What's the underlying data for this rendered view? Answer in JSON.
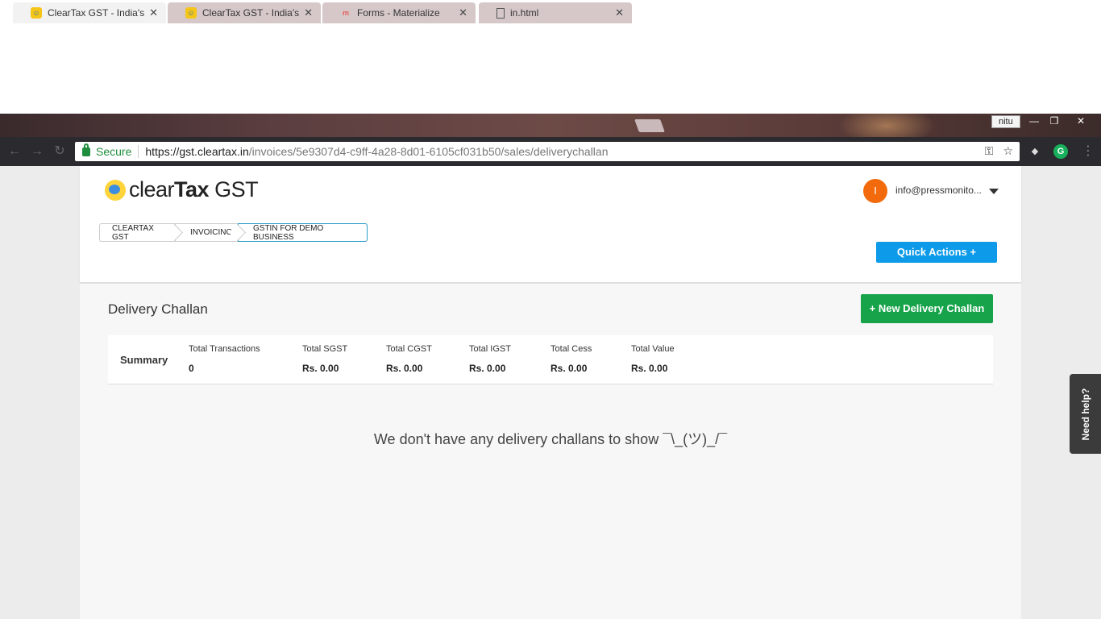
{
  "browser": {
    "tabs": [
      {
        "title": "ClearTax GST - India's fir",
        "favicon": "cleartax-favicon",
        "active": true
      },
      {
        "title": "ClearTax GST - India's fir",
        "favicon": "cleartax-favicon",
        "active": false
      },
      {
        "title": "Forms - Materialize",
        "favicon": "materialize-favicon",
        "active": false
      },
      {
        "title": "in.html",
        "favicon": "file-icon",
        "active": false
      }
    ],
    "profile_name": "nitu",
    "secure_label": "Secure",
    "url_host": "https://gst.cleartax.in",
    "url_path": "/invoices/5e9307d4-c9ff-4a28-8d01-6105cf031b50/sales/deliverychallan"
  },
  "header": {
    "logo_text_light": "clear",
    "logo_text_bold": "Tax",
    "logo_text_suffix": " GST",
    "avatar_initial": "I",
    "user_email": "info@pressmonito...",
    "breadcrumb": [
      "CLEARTAX GST",
      "INVOICING",
      "GSTIN FOR DEMO BUSINESS"
    ],
    "quick_actions_label": "Quick Actions +"
  },
  "main": {
    "title": "Delivery Challan",
    "new_button_label": "+ New Delivery Challan",
    "summary": {
      "label": "Summary",
      "metrics": [
        {
          "label": "Total Transactions",
          "value": "0"
        },
        {
          "label": "Total SGST",
          "value": "Rs. 0.00"
        },
        {
          "label": "Total CGST",
          "value": "Rs. 0.00"
        },
        {
          "label": "Total IGST",
          "value": "Rs. 0.00"
        },
        {
          "label": "Total Cess",
          "value": "Rs. 0.00"
        },
        {
          "label": "Total Value",
          "value": "Rs. 0.00"
        }
      ]
    },
    "empty_message": "We don't have any delivery challans to show ¯\\_(ツ)_/¯"
  },
  "help": {
    "label": "Need help?"
  },
  "colors": {
    "primary_blue": "#0d9ae8",
    "primary_green": "#17a34a",
    "avatar_orange": "#f26a0c"
  }
}
